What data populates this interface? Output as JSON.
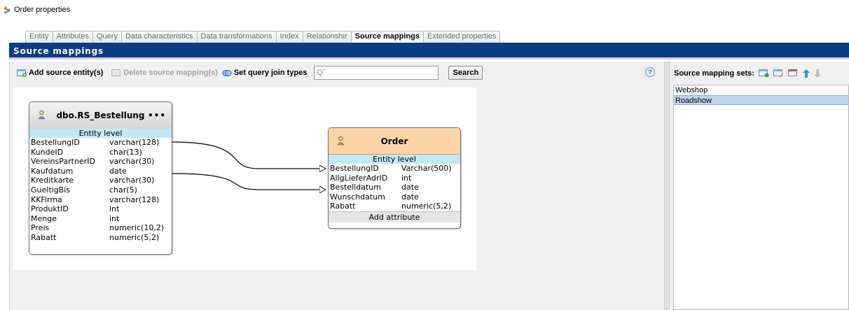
{
  "window": {
    "title": "Order properties"
  },
  "tabs": [
    {
      "label": "Entity",
      "active": false
    },
    {
      "label": "Attributes",
      "active": false
    },
    {
      "label": "Query",
      "active": false
    },
    {
      "label": "Data characteristics",
      "active": false
    },
    {
      "label": "Data transformations",
      "active": false
    },
    {
      "label": "Index",
      "active": false
    },
    {
      "label": "Relationshir",
      "active": false
    },
    {
      "label": "Source mappings",
      "active": true
    },
    {
      "label": "Extended properties",
      "active": false
    }
  ],
  "header": {
    "title": "Source mappings"
  },
  "toolbar": {
    "add_label": "Add source entity(s)",
    "delete_label": "Delete source mapping(s)",
    "join_label": "Set query join types",
    "search_placeholder": "Qˇ",
    "search_button": "Search",
    "help_glyph": "?"
  },
  "source_entity": {
    "name": "dbo.RS_Bestellung",
    "more": "•••",
    "level": "Entity  level",
    "attributes": [
      {
        "name": "BestellungID",
        "type": "varchar(128)"
      },
      {
        "name": "KundeID",
        "type": "char(13)"
      },
      {
        "name": "VereinsPartnerID",
        "type": "varchar(30)"
      },
      {
        "name": "Kaufdatum",
        "type": "date"
      },
      {
        "name": "Kreditkarte",
        "type": "varchar(30)"
      },
      {
        "name": "GueltigBis",
        "type": "char(5)"
      },
      {
        "name": "KKFirma",
        "type": "varchar(128)"
      },
      {
        "name": "ProduktID",
        "type": "int"
      },
      {
        "name": "Menge",
        "type": "int"
      },
      {
        "name": "Preis",
        "type": "numeric(10,2)"
      },
      {
        "name": "Rabatt",
        "type": "numeric(5,2)"
      }
    ]
  },
  "target_entity": {
    "name": "Order",
    "level": "Entity  level",
    "attributes": [
      {
        "name": "BestellungID",
        "type": "Varchar(500)"
      },
      {
        "name": "AllgLieferAdrID",
        "type": "int"
      },
      {
        "name": "Bestelldatum",
        "type": "date"
      },
      {
        "name": "Wunschdatum",
        "type": "date"
      },
      {
        "name": "Rabatt",
        "type": "numeric(5,2)"
      }
    ],
    "add_attribute": "Add attribute"
  },
  "mappings": [
    {
      "from": "BestellungID",
      "to": "BestellungID"
    },
    {
      "from": "Kaufdatum",
      "to": "Bestelldatum"
    }
  ],
  "right_pane": {
    "title": "Source mapping sets:",
    "items": [
      {
        "label": "Webshop",
        "selected": false
      },
      {
        "label": "Roadshow",
        "selected": true
      }
    ]
  },
  "colors": {
    "header_bg": "#0c3d84",
    "target_header": "#fdd4a6",
    "level_row": "#c4e8f2",
    "selected_row": "#bcd3ec"
  }
}
